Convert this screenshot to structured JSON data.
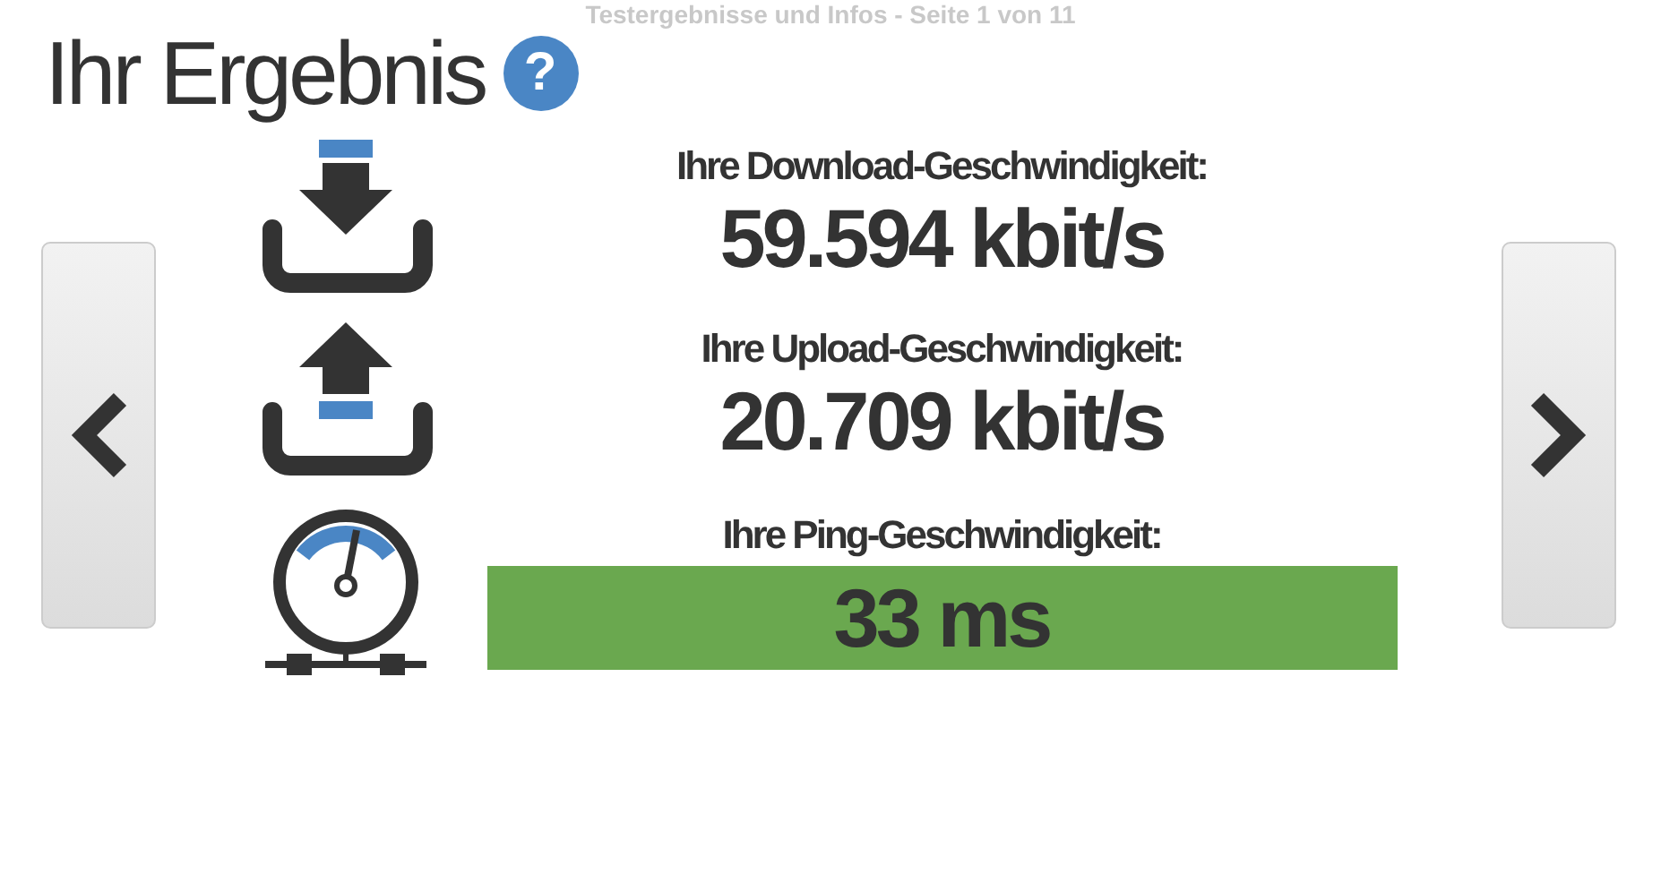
{
  "header": "Testergebnisse und Infos - Seite 1 von 11",
  "title": "Ihr Ergebnis",
  "help": "?",
  "results": [
    {
      "kind": "download",
      "label": "Ihre Download-Geschwindigkeit:",
      "value": "59.594 kbit/s"
    },
    {
      "kind": "upload",
      "label": "Ihre Upload-Geschwindigkeit:",
      "value": "20.709 kbit/s"
    },
    {
      "kind": "ping",
      "label": "Ihre Ping-Geschwindigkeit:",
      "value": "33 ms",
      "color": "#6aa84f"
    }
  ]
}
